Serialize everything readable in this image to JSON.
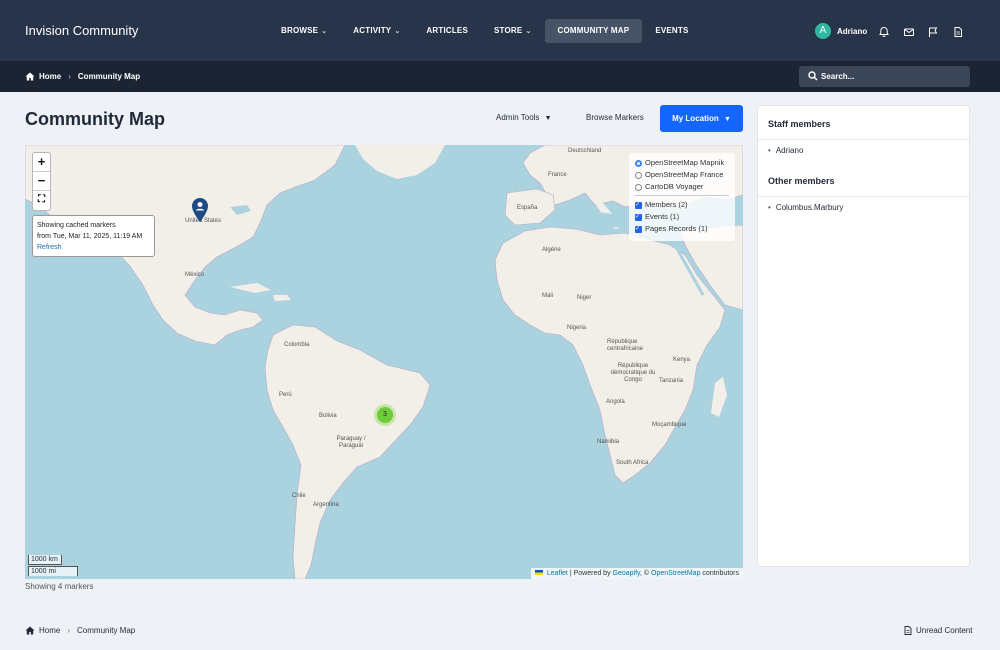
{
  "header": {
    "brand": "Invision Community",
    "nav": [
      {
        "label": "Browse",
        "has_menu": true
      },
      {
        "label": "Activity",
        "has_menu": true
      },
      {
        "label": "Articles",
        "has_menu": false
      },
      {
        "label": "Store",
        "has_menu": true
      },
      {
        "label": "Community Map",
        "has_menu": false,
        "active": true
      },
      {
        "label": "Events",
        "has_menu": false
      }
    ],
    "user": {
      "avatar_letter": "A",
      "name": "Adriano",
      "avatar_color": "#2fb8a0"
    }
  },
  "breadcrumb": {
    "home": "Home",
    "current": "Community Map"
  },
  "search": {
    "placeholder": "Search..."
  },
  "page": {
    "title": "Community Map",
    "admin_tools": "Admin Tools",
    "browse_markers": "Browse Markers",
    "my_location": "My Location"
  },
  "map": {
    "cache_line1": "Showing cached markers",
    "cache_line2": "from Tue, Mar 11, 2025, 11:19 AM",
    "refresh": "Refresh",
    "base_layers": [
      "OpenStreetMap Mapnik",
      "OpenStreetMap France",
      "CartoDB Voyager"
    ],
    "overlays": [
      "Members (2)",
      "Events (1)",
      "Pages Records (1)"
    ],
    "cluster_count": "3",
    "scale_km": "1000 km",
    "scale_mi": "1000 mi",
    "attribution": {
      "leaflet": "Leaflet",
      "powered": "| Powered by",
      "geoapify": "Geoapify",
      "osm_prefix": ", ©",
      "osm": "OpenStreetMap",
      "suffix": "contributors"
    },
    "labels": {
      "us": "United States",
      "mexico": "México",
      "colombia": "Colombia",
      "peru": "Perú",
      "bolivia": "Bolivia",
      "paraguay": "Paraguay / Paraguái",
      "chile": "Chile",
      "argentina": "Argentina",
      "deutschland": "Deutschland",
      "france": "France",
      "espana": "España",
      "algerie": "Algérie",
      "mali": "Mali",
      "niger": "Niger",
      "nigeria": "Nigeria",
      "rdc": "République démocratique du Congo",
      "centrafrique": "République centrafricaine",
      "angola": "Angola",
      "namibia": "Namibia",
      "south_africa": "South Africa",
      "kenya": "Kenya",
      "tanzania": "Tanzania",
      "mocambique": "Moçambique"
    },
    "colors": {
      "water": "#aad3df",
      "land": "#f2efe9",
      "accent": "#1565ff",
      "cluster": "#6ecc39"
    }
  },
  "status": {
    "showing": "Showing 4 markers"
  },
  "sidebar": {
    "staff_title": "Staff members",
    "staff": [
      "Adriano"
    ],
    "other_title": "Other members",
    "others": [
      "Columbus.Marbury"
    ]
  },
  "footer": {
    "home": "Home",
    "current": "Community Map",
    "unread": "Unread Content"
  }
}
